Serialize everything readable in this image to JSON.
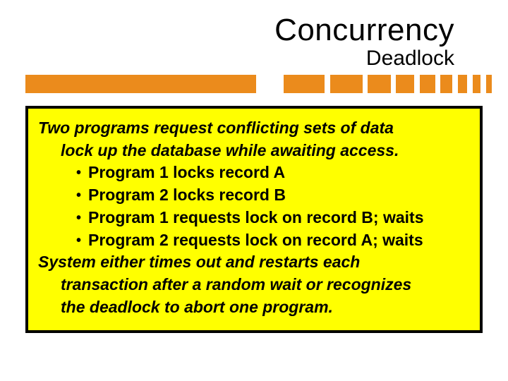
{
  "title": "Concurrency",
  "subtitle": "Deadlock",
  "body": {
    "para1_line1": "Two programs request conflicting sets of data",
    "para1_line2": "lock up the database while awaiting access.",
    "bullets": [
      "Program 1 locks record A",
      "Program 2 locks record B",
      "Program 1 requests  lock on record B; waits",
      "Program 2 requests  lock on record A; waits"
    ],
    "para2_line1": "System either times out and restarts each",
    "para2_line2": "transaction after a random wait or recognizes",
    "para2_line3": "the deadlock to abort one program."
  },
  "colors": {
    "accent": "#eb8b1c",
    "highlight": "#ffff00",
    "border": "#000000"
  }
}
